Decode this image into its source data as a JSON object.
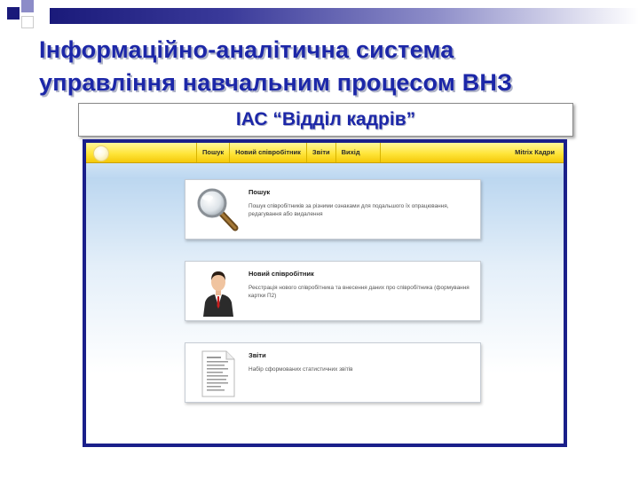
{
  "slide": {
    "title_line1": "Інформаційно-аналітична система",
    "title_line2": "управління навчальним процесом ВНЗ",
    "subtitle": "ІАС “Відділ кадрів”"
  },
  "app": {
    "nav": [
      {
        "label": "Пошук"
      },
      {
        "label": "Новий співробітник"
      },
      {
        "label": "Звіти"
      },
      {
        "label": "Вихід"
      }
    ],
    "brand": "Mitrix Кадри",
    "cards": [
      {
        "title": "Пошук",
        "desc": "Пошук співробітників за різними ознаками для подальшого їх опрацювання, редагування або видалення",
        "icon": "magnifier-icon"
      },
      {
        "title": "Новий співробітник",
        "desc": "Реєстрація нового співробітника та внесення даних про співробітника (формування картки П2)",
        "icon": "employee-icon"
      },
      {
        "title": "Звіти",
        "desc": "Набір сформованих статистичних звітів",
        "icon": "report-document-icon"
      }
    ]
  },
  "colors": {
    "title_blue": "#1c27a8",
    "frame_navy": "#1a1f8a",
    "header_yellow": "#ffe53a"
  }
}
